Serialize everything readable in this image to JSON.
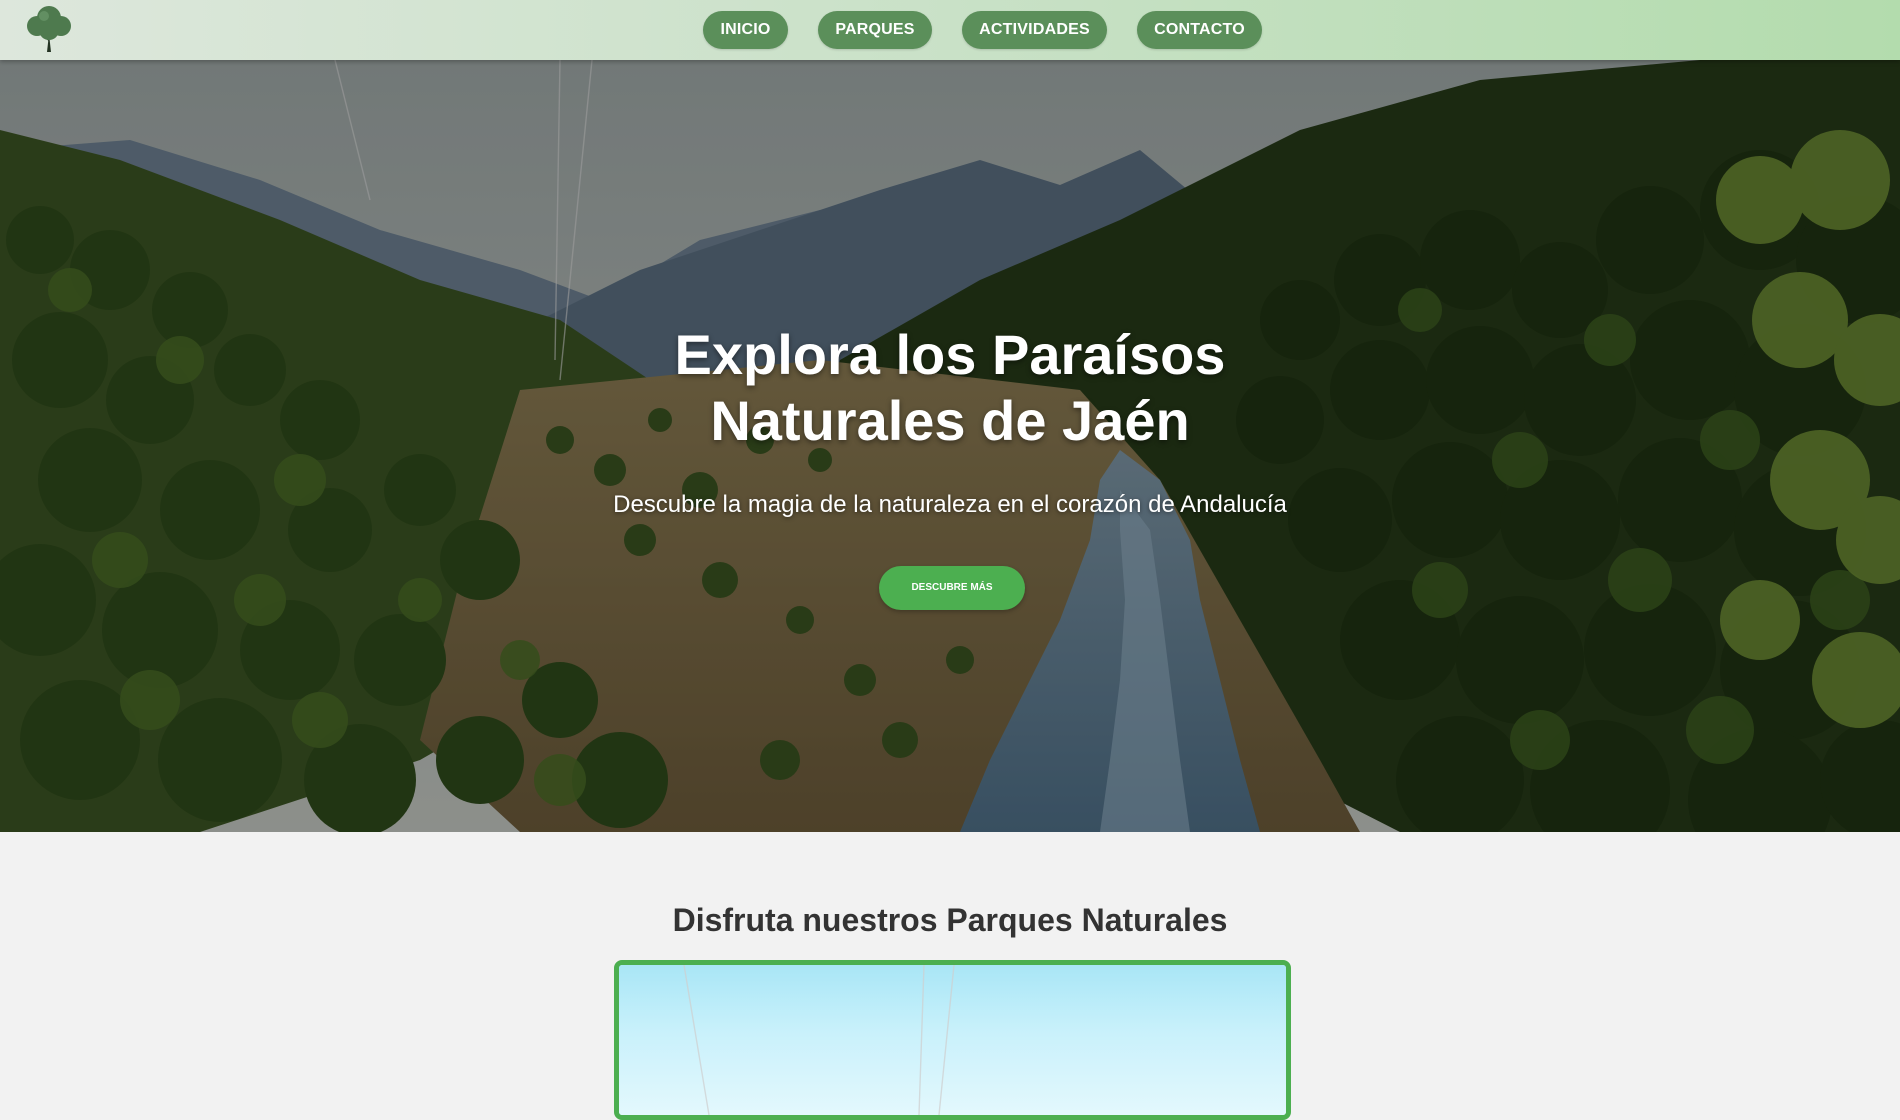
{
  "nav": {
    "logo_icon": "tree-icon",
    "links": [
      {
        "label": "INICIO"
      },
      {
        "label": "PARQUES"
      },
      {
        "label": "ACTIVIDADES"
      },
      {
        "label": "CONTACTO"
      }
    ]
  },
  "hero": {
    "title_line1": "Explora los Paraísos",
    "title_line2": "Naturales de Jaén",
    "subtitle": "Descubre la magia de la naturaleza en el corazón de Andalucía",
    "cta_label": "DESCUBRE MÁS"
  },
  "parks": {
    "title": "Disfruta nuestros Parques Naturales"
  },
  "colors": {
    "nav_button": "#5b8f5a",
    "accent_green": "#4caf50",
    "section_bg": "#f2f2f2",
    "heading_text": "#333333"
  }
}
